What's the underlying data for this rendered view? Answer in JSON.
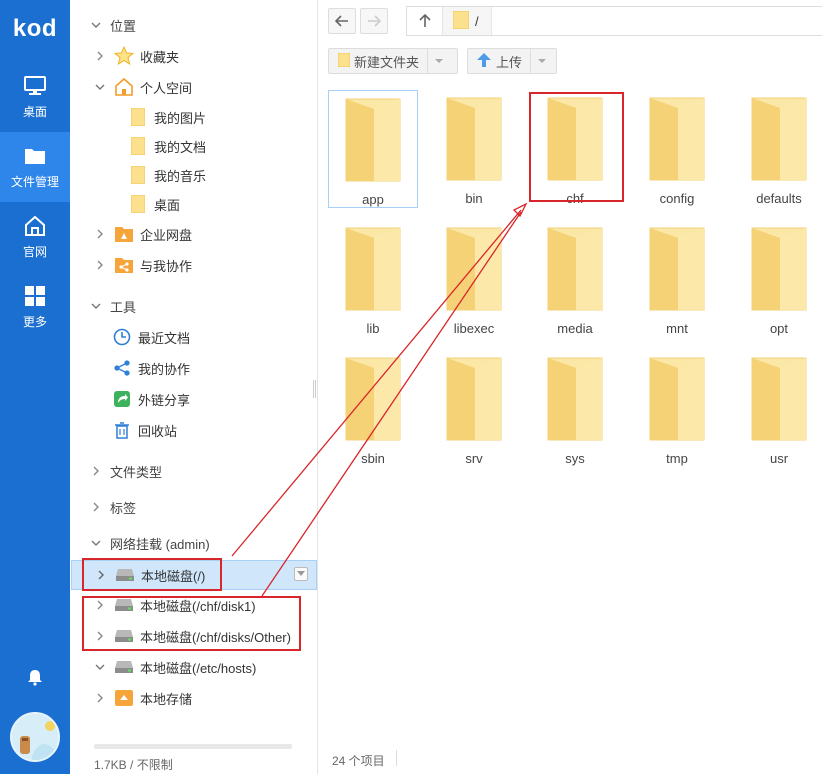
{
  "app": {
    "logo": "kod"
  },
  "rail": {
    "items": [
      {
        "label": "桌面",
        "icon": "monitor-icon"
      },
      {
        "label": "文件管理",
        "icon": "folder-icon",
        "active": true
      },
      {
        "label": "官网",
        "icon": "home-icon"
      },
      {
        "label": "更多",
        "icon": "grid-icon"
      }
    ]
  },
  "tree": {
    "location": "位置",
    "favorites": "收藏夹",
    "personal": "个人空间",
    "my_pictures": "我的图片",
    "my_docs": "我的文档",
    "my_music": "我的音乐",
    "desktop": "桌面",
    "enterprise": "企业网盘",
    "collab": "与我协作",
    "tools": "工具",
    "recent": "最近文档",
    "my_collab": "我的协作",
    "share_link": "外链分享",
    "recycle": "回收站",
    "file_types": "文件类型",
    "tags": "标签",
    "net_mount": "网络挂载 (admin)",
    "disk_root": "本地磁盘(/)",
    "disk1": "本地磁盘(/chf/disk1)",
    "disk_other": "本地磁盘(/chf/disks/Other)",
    "disk_hosts": "本地磁盘(/etc/hosts)",
    "local_storage": "本地存储"
  },
  "quota": {
    "text": "1.7KB / 不限制",
    "fraction": 0.0
  },
  "nav": {
    "path": "/"
  },
  "toolbar": {
    "new_folder": "新建文件夹",
    "upload": "上传"
  },
  "files": [
    {
      "name": "app",
      "selected": true
    },
    {
      "name": "bin"
    },
    {
      "name": "chf"
    },
    {
      "name": "config"
    },
    {
      "name": "defaults"
    },
    {
      "name": "lib"
    },
    {
      "name": "libexec"
    },
    {
      "name": "media"
    },
    {
      "name": "mnt"
    },
    {
      "name": "opt"
    },
    {
      "name": "sbin"
    },
    {
      "name": "srv"
    },
    {
      "name": "sys"
    },
    {
      "name": "tmp"
    },
    {
      "name": "usr"
    }
  ],
  "status": {
    "count": "24 个项目"
  },
  "colors": {
    "rail": "#1b6fd0",
    "rail_active": "#2f86ea",
    "annotation": "#d9262a",
    "folder": "#f8d775"
  }
}
